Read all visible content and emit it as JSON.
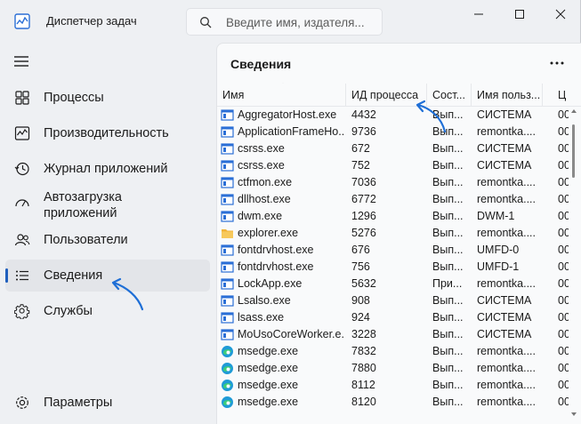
{
  "app": {
    "title": "Диспетчер задач"
  },
  "search": {
    "placeholder": "Введите имя, издателя..."
  },
  "sidebar": {
    "items": [
      {
        "label": "Процессы",
        "icon": "processes-icon",
        "active": false
      },
      {
        "label": "Производительность",
        "icon": "performance-icon",
        "active": false
      },
      {
        "label": "Журнал приложений",
        "icon": "app-history-icon",
        "active": false
      },
      {
        "label": "Автозагрузка приложений",
        "icon": "startup-icon",
        "active": false
      },
      {
        "label": "Пользователи",
        "icon": "users-icon",
        "active": false
      },
      {
        "label": "Сведения",
        "icon": "details-icon",
        "active": true
      },
      {
        "label": "Службы",
        "icon": "services-icon",
        "active": false
      }
    ],
    "settings_label": "Параметры"
  },
  "main": {
    "title": "Сведения",
    "columns": [
      "Имя",
      "ИД процесса",
      "Сост...",
      "Имя польз...",
      "Ц"
    ],
    "rows": [
      {
        "icon": "app",
        "name": "AggregatorHost.exe",
        "pid": "4432",
        "status": "Вып...",
        "user": "СИСТЕМА",
        "cpu": "00"
      },
      {
        "icon": "app",
        "name": "ApplicationFrameHo...",
        "pid": "9736",
        "status": "Вып...",
        "user": "remontka....",
        "cpu": "00"
      },
      {
        "icon": "app",
        "name": "csrss.exe",
        "pid": "672",
        "status": "Вып...",
        "user": "СИСТЕМА",
        "cpu": "00"
      },
      {
        "icon": "app",
        "name": "csrss.exe",
        "pid": "752",
        "status": "Вып...",
        "user": "СИСТЕМА",
        "cpu": "00"
      },
      {
        "icon": "app",
        "name": "ctfmon.exe",
        "pid": "7036",
        "status": "Вып...",
        "user": "remontka....",
        "cpu": "00"
      },
      {
        "icon": "app",
        "name": "dllhost.exe",
        "pid": "6772",
        "status": "Вып...",
        "user": "remontka....",
        "cpu": "00"
      },
      {
        "icon": "app",
        "name": "dwm.exe",
        "pid": "1296",
        "status": "Вып...",
        "user": "DWM-1",
        "cpu": "00"
      },
      {
        "icon": "folder",
        "name": "explorer.exe",
        "pid": "5276",
        "status": "Вып...",
        "user": "remontka....",
        "cpu": "00"
      },
      {
        "icon": "app",
        "name": "fontdrvhost.exe",
        "pid": "676",
        "status": "Вып...",
        "user": "UMFD-0",
        "cpu": "00"
      },
      {
        "icon": "app",
        "name": "fontdrvhost.exe",
        "pid": "756",
        "status": "Вып...",
        "user": "UMFD-1",
        "cpu": "00"
      },
      {
        "icon": "app",
        "name": "LockApp.exe",
        "pid": "5632",
        "status": "При...",
        "user": "remontka....",
        "cpu": "00"
      },
      {
        "icon": "app",
        "name": "Lsalso.exe",
        "pid": "908",
        "status": "Вып...",
        "user": "СИСТЕМА",
        "cpu": "00"
      },
      {
        "icon": "app",
        "name": "lsass.exe",
        "pid": "924",
        "status": "Вып...",
        "user": "СИСТЕМА",
        "cpu": "00"
      },
      {
        "icon": "app",
        "name": "MoUsoCoreWorker.e...",
        "pid": "3228",
        "status": "Вып...",
        "user": "СИСТЕМА",
        "cpu": "00"
      },
      {
        "icon": "edge",
        "name": "msedge.exe",
        "pid": "7832",
        "status": "Вып...",
        "user": "remontka....",
        "cpu": "00"
      },
      {
        "icon": "edge",
        "name": "msedge.exe",
        "pid": "7880",
        "status": "Вып...",
        "user": "remontka....",
        "cpu": "00"
      },
      {
        "icon": "edge",
        "name": "msedge.exe",
        "pid": "8112",
        "status": "Вып...",
        "user": "remontka....",
        "cpu": "00"
      },
      {
        "icon": "edge",
        "name": "msedge.exe",
        "pid": "8120",
        "status": "Вып...",
        "user": "remontka....",
        "cpu": "00"
      }
    ]
  },
  "colors": {
    "accent": "#1f5fbd",
    "app_icon_blue": "#2b6fd6",
    "folder": "#f2b43a"
  }
}
